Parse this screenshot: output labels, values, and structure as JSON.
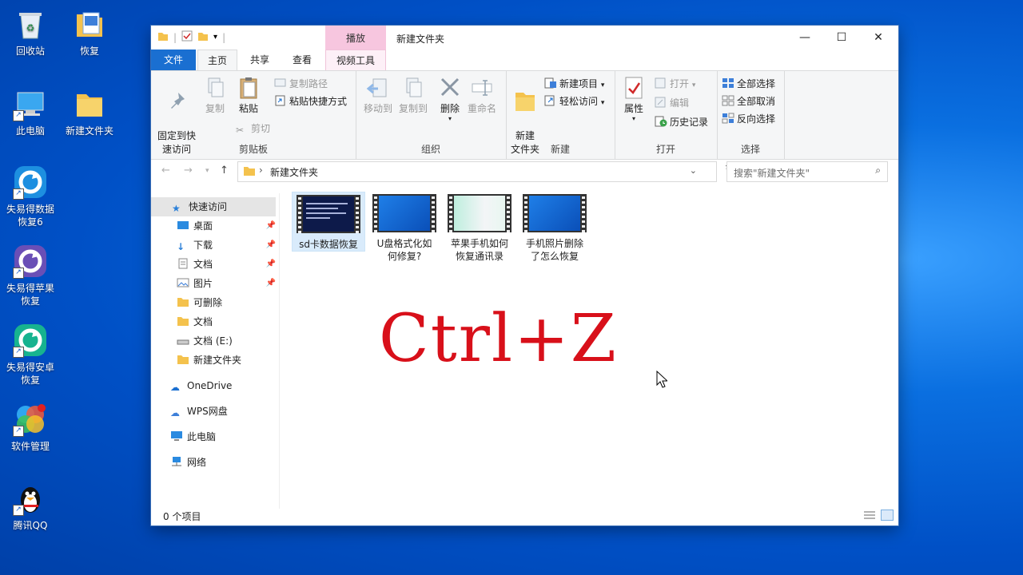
{
  "desktop": {
    "icons": [
      {
        "label": "回收站"
      },
      {
        "label": "恢复"
      },
      {
        "label": "此电脑"
      },
      {
        "label": "新建文件夹"
      },
      {
        "label": "失易得数据\n恢复6"
      },
      {
        "label": "失易得苹果\n恢复"
      },
      {
        "label": "失易得安卓\n恢复"
      },
      {
        "label": "软件管理"
      },
      {
        "label": "腾讯QQ"
      }
    ]
  },
  "window": {
    "title": "新建文件夹",
    "context_tab_header": "播放",
    "controls": {
      "minimize": "—",
      "maximize": "☐",
      "close": "✕"
    },
    "tabs": [
      "文件",
      "主页",
      "共享",
      "查看",
      "视频工具"
    ],
    "ribbon": {
      "clipboard": {
        "name": "剪贴板",
        "pin": "固定到快\n速访问",
        "copy": "复制",
        "paste": "粘贴",
        "copy_path": "复制路径",
        "paste_shortcut": "粘贴快捷方式",
        "cut": "剪切"
      },
      "organize": {
        "name": "组织",
        "move_to": "移动到",
        "copy_to": "复制到",
        "delete": "删除",
        "rename": "重命名"
      },
      "new": {
        "name": "新建",
        "new_folder": "新建\n文件夹",
        "new_item": "新建项目",
        "easy_access": "轻松访问"
      },
      "open": {
        "name": "打开",
        "properties": "属性",
        "open": "打开",
        "edit": "编辑",
        "history": "历史记录"
      },
      "select": {
        "name": "选择",
        "select_all": "全部选择",
        "select_none": "全部取消",
        "invert": "反向选择"
      }
    },
    "address": {
      "path": "新建文件夹",
      "search_placeholder": "搜索\"新建文件夹\""
    },
    "nav": {
      "quick_access": "快速访问",
      "items": [
        "桌面",
        "下载",
        "文档",
        "图片",
        "可删除",
        "文档",
        "文档 (E:)",
        "新建文件夹"
      ],
      "onedrive": "OneDrive",
      "wps": "WPS网盘",
      "this_pc": "此电脑",
      "network": "网络"
    },
    "files": [
      {
        "name": "sd卡数据恢复"
      },
      {
        "name": "U盘格式化如\n何修复?"
      },
      {
        "name": "苹果手机如何\n恢复通讯录"
      },
      {
        "name": "手机照片删除\n了怎么恢复"
      }
    ],
    "overlay_text": "Ctrl+Z",
    "status": "0 个项目"
  },
  "colors": {
    "accent": "#1a6fd1",
    "context_tab": "#f7c6df",
    "overlay": "#d8101a"
  }
}
